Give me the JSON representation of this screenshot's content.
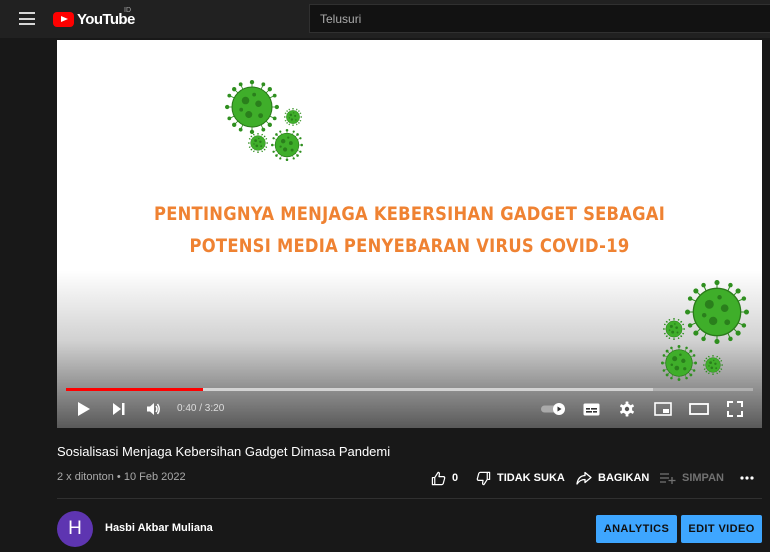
{
  "topbar": {
    "logo_text": "YouTube",
    "region": "ID",
    "search_placeholder": "Telusuri"
  },
  "player": {
    "slide_title_line1": "PENTINGNYA MENJAGA KEBERSIHAN GADGET SEBAGAI",
    "slide_title_line2": "POTENSI MEDIA PENYEBARAN VIRUS COVID-19",
    "time_display": "0:40 / 3:20",
    "progress_played_fraction": 0.2,
    "progress_loaded_fraction": 0.855,
    "icons": [
      "play-icon",
      "next-icon",
      "volume-icon",
      "autoplay-toggle-icon",
      "subtitles-icon",
      "settings-icon",
      "miniplayer-icon",
      "theater-icon",
      "fullscreen-icon"
    ]
  },
  "video": {
    "title": "Sosialisasi Menjaga Kebersihan Gadget Dimasa Pandemi",
    "meta": "2 x ditonton • 10 Feb 2022"
  },
  "actions": {
    "like_count": "0",
    "dislike_label": "TIDAK SUKA",
    "share_label": "BAGIKAN",
    "save_label": "SIMPAN"
  },
  "channel": {
    "avatar_letter": "H",
    "name": "Hasbi Akbar Muliana",
    "analytics_label": "ANALYTICS",
    "edit_label": "EDIT VIDEO"
  },
  "colors": {
    "accent": "#3ea6ff",
    "progress": "#ff0000",
    "slide_text": "#ef8232",
    "virus": "#3fae2a"
  }
}
